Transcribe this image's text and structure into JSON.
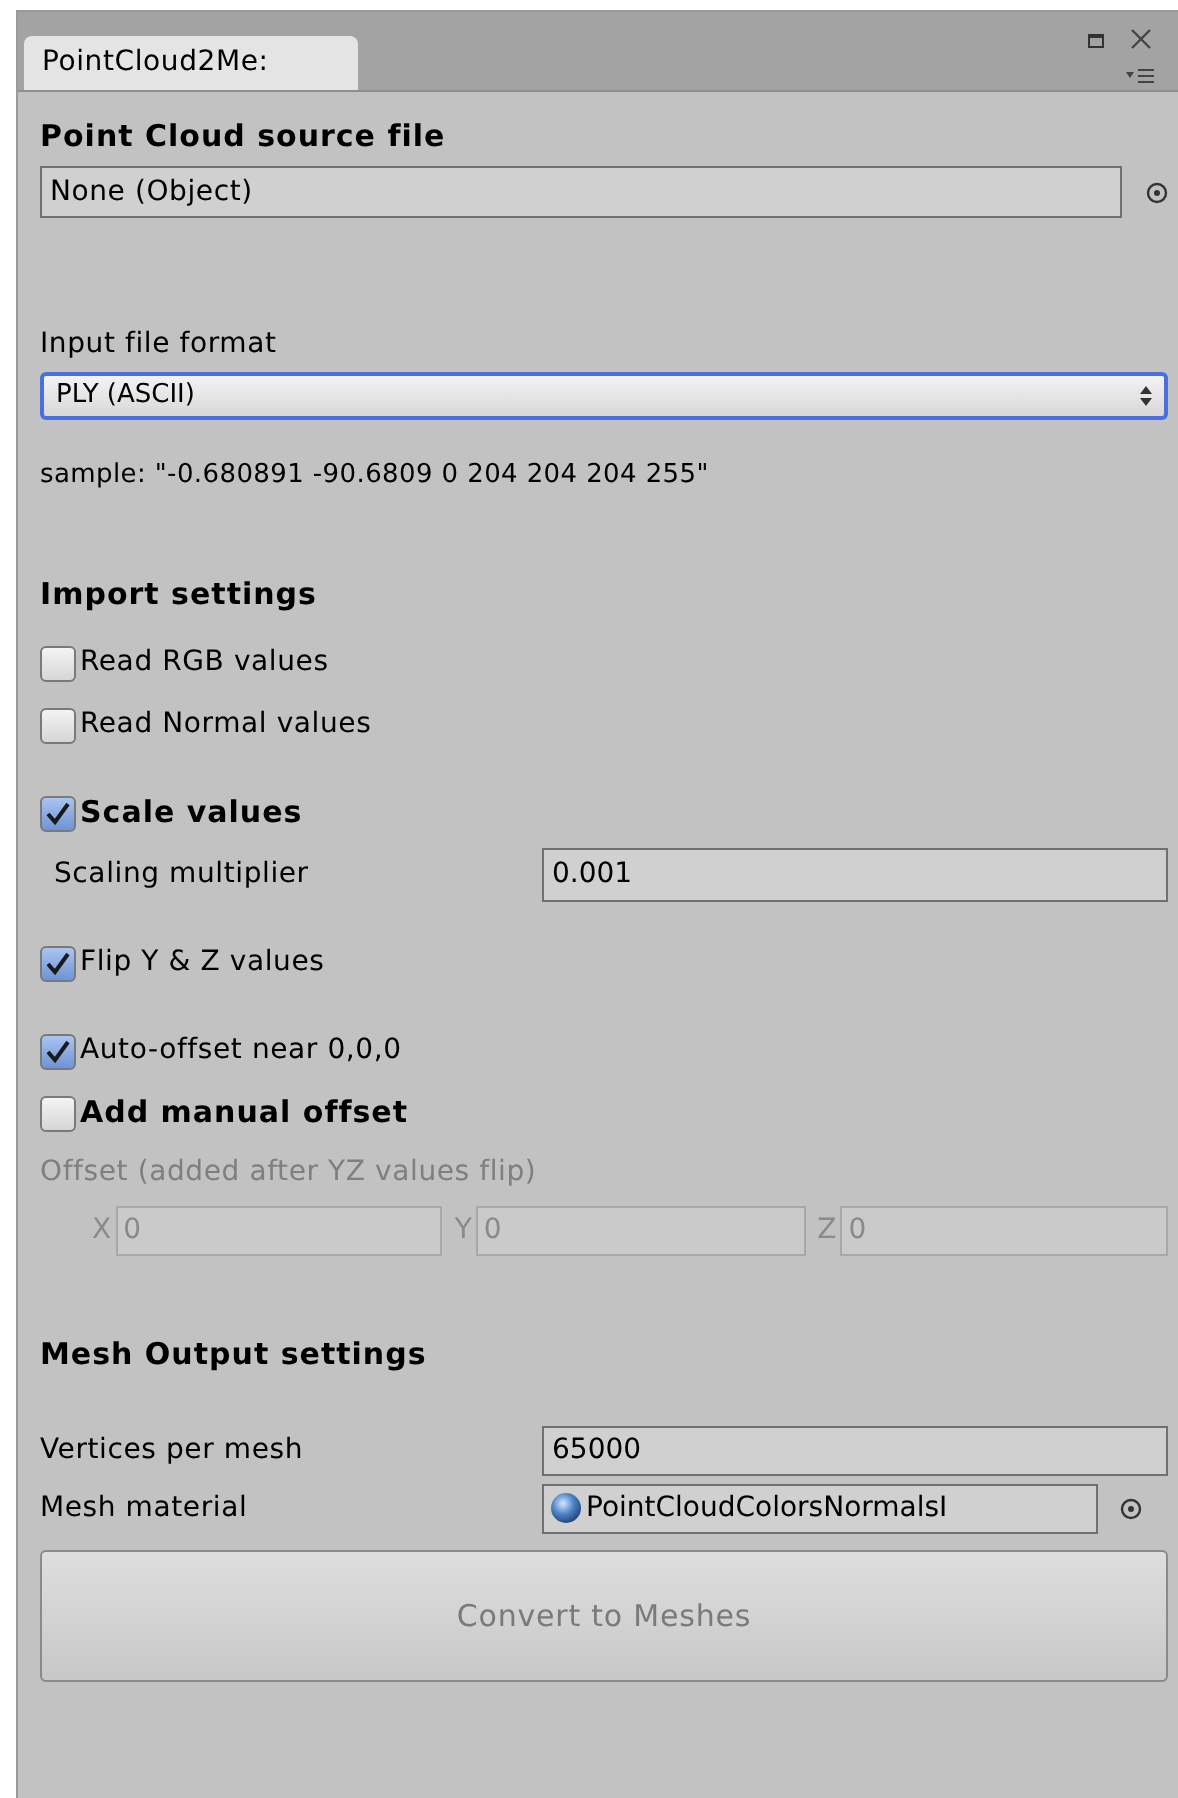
{
  "tab": {
    "label": "PointCloud2Me:",
    "selected": true
  },
  "source": {
    "heading": "Point Cloud source file",
    "value": "None (Object)"
  },
  "format": {
    "label": "Input file format",
    "value": "PLY (ASCII)",
    "focused": true,
    "sample": "sample: \"-0.680891 -90.6809 0 204 204 204 255\""
  },
  "import_settings": {
    "heading": "Import settings",
    "groups": [
      {
        "items": [
          {
            "kind": "checkbox",
            "label": "Read RGB values",
            "checked": false,
            "bold": false
          },
          {
            "kind": "checkbox",
            "label": "Read Normal values",
            "checked": false,
            "bold": false
          }
        ]
      },
      {
        "items": [
          {
            "kind": "checkbox",
            "label": "Scale values",
            "checked": true,
            "bold": true
          },
          {
            "kind": "field",
            "label": "Scaling multiplier",
            "value": "0.001",
            "indented": true
          }
        ]
      },
      {
        "items": [
          {
            "kind": "checkbox",
            "label": "Flip Y & Z values",
            "checked": true,
            "bold": false
          }
        ]
      },
      {
        "items": [
          {
            "kind": "checkbox",
            "label": "Auto-offset near 0,0,0",
            "checked": true,
            "bold": false
          },
          {
            "kind": "checkbox",
            "label": "Add manual offset",
            "checked": false,
            "bold": true
          },
          {
            "kind": "caption",
            "label": "Offset (added after YZ values flip)",
            "disabled": true
          },
          {
            "kind": "vector",
            "disabled": true,
            "components": [
              {
                "axis": "X",
                "value": "0"
              },
              {
                "axis": "Y",
                "value": "0"
              },
              {
                "axis": "Z",
                "value": "0"
              }
            ]
          }
        ]
      }
    ]
  },
  "mesh_output": {
    "heading": "Mesh Output settings",
    "vertices": {
      "label": "Vertices per mesh",
      "value": "65000"
    },
    "material": {
      "label": "Mesh material",
      "value": "PointCloudColorsNormalsI"
    }
  },
  "convert_button": {
    "label": "Convert to Meshes",
    "disabled": true
  }
}
